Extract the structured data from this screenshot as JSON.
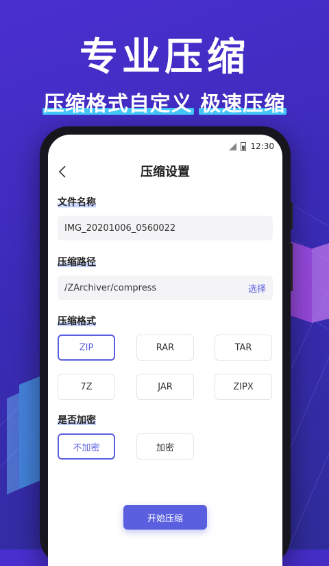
{
  "banner": {
    "headline": "专业压缩",
    "subline_part1": "压缩格式自定义",
    "subline_part2": "极速压缩"
  },
  "status_bar": {
    "time": "12:30"
  },
  "header": {
    "title": "压缩设置",
    "back_icon": "chevron-left-icon"
  },
  "file_name": {
    "label": "文件名称",
    "value": "IMG_20201006_0560022"
  },
  "path": {
    "label": "压缩路径",
    "value": "/ZArchiver/compress",
    "action": "选择"
  },
  "format": {
    "label": "压缩格式",
    "options": [
      "ZIP",
      "RAR",
      "TAR",
      "7Z",
      "JAR",
      "ZIPX"
    ],
    "selected": "ZIP"
  },
  "encrypt": {
    "label": "是否加密",
    "options": [
      "不加密",
      "加密"
    ],
    "selected": "不加密"
  },
  "start_button": "开始压缩",
  "colors": {
    "accent": "#5a5fe0",
    "background": "#3b2bb8",
    "highlight": "#43c6f7"
  }
}
